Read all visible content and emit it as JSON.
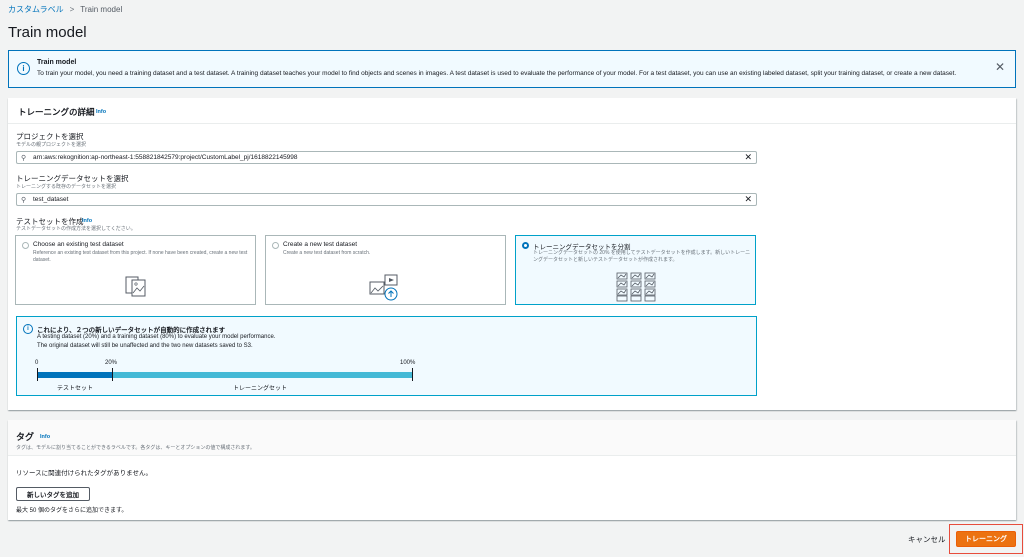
{
  "breadcrumb": {
    "parent": "カスタムラベル",
    "current": "Train model"
  },
  "page_title": "Train model",
  "flash": {
    "title": "Train model",
    "message": "To train your model, you need a training dataset and a test dataset. A training dataset teaches your model to find objects and scenes in images. A test dataset is used to evaluate the performance of your model. For a test dataset, you can use an existing labeled dataset, split your training dataset, or create a new dataset."
  },
  "training_details": {
    "title": "トレーニングの詳細",
    "info": "Info",
    "project": {
      "label": "プロジェクトを選択",
      "desc": "モデルの親プロジェクトを選択",
      "value": "arn:aws:rekognition:ap-northeast-1:558821842579:project/CustomLabel_pj/1618822145998"
    },
    "training_dataset": {
      "label": "トレーニングデータセットを選択",
      "desc": "トレーニングする既存のデータセットを選択",
      "value": "test_dataset"
    },
    "test_set": {
      "label": "テストセットを作成",
      "info": "Info",
      "desc": "テストデータセットの作成方法を選択してください。",
      "options": [
        {
          "title": "Choose an existing test dataset",
          "desc": "Reference an existing test dataset from this project. If none have been created, create a new test dataset."
        },
        {
          "title": "Create a new test dataset",
          "desc": "Create a new test dataset from scratch."
        },
        {
          "title": "トレーニングデータセットを分割",
          "desc": "トレーニングデータセットの 20% を使用してテストデータセットを作成します。新しいトレーニングデータセットと新しいテストデータセットが作成されます。"
        }
      ]
    },
    "split_alert": {
      "title": "これにより、２つの新しいデータセットが自動的に作成されます",
      "line1": "A testing dataset (20%) and a training dataset (80%) to evaluate your model performance.",
      "line2": "The original dataset will still be unaffected and the two new datasets saved to S3.",
      "tick_start": "0",
      "tick_mid": "20%",
      "tick_end": "100%",
      "test_label": "テストセット",
      "train_label": "トレーニングセット",
      "test_fraction": 0.2
    }
  },
  "tags": {
    "title": "タグ",
    "info": "Info",
    "desc": "タグは、モデルに割り当てることができるラベルです。各タグは、キーとオプションの値で構成されます。",
    "empty": "リソースに関連付けられたタグがありません。",
    "add_button": "新しいタグを追加",
    "limit": "最大 50 個のタグをさらに追加できます。"
  },
  "footer": {
    "cancel": "キャンセル",
    "train": "トレーニング"
  },
  "colors": {
    "accent": "#0073bb",
    "primary": "#ec7211",
    "selected_tile_bg": "#f1faff"
  }
}
